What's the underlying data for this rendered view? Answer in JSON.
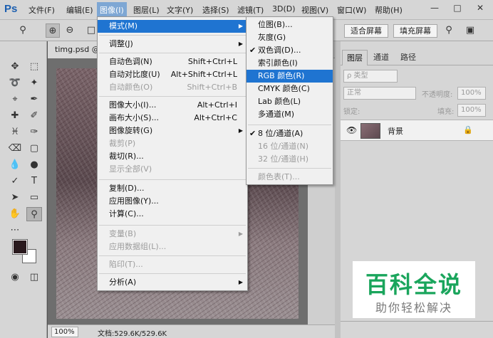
{
  "app": {
    "logo": "Ps"
  },
  "menubar": {
    "items": [
      "文件(F)",
      "编辑(E)",
      "图像(I)",
      "图层(L)",
      "文字(Y)",
      "选择(S)",
      "滤镜(T)",
      "3D(D)",
      "视图(V)",
      "窗口(W)",
      "帮助(H)"
    ],
    "active_index": 2
  },
  "window_controls": {
    "minimize": "—",
    "maximize": "□",
    "close": "✕"
  },
  "options_bar": {
    "fit_screen": "适合屏幕",
    "fill_screen": "填充屏幕"
  },
  "document": {
    "tab_label": "timg.psd @",
    "zoom": "100%",
    "info": "文档:529.6K/529.6K"
  },
  "image_menu": {
    "items": [
      {
        "label": "模式(M)",
        "shortcut": "",
        "submenu": true,
        "disabled": false,
        "highlighted": true
      },
      {
        "label": "调整(J)",
        "shortcut": "",
        "submenu": true,
        "disabled": false,
        "highlighted": false
      },
      {
        "label": "自动色调(N)",
        "shortcut": "Shift+Ctrl+L",
        "submenu": false,
        "disabled": false,
        "highlighted": false
      },
      {
        "label": "自动对比度(U)",
        "shortcut": "Alt+Shift+Ctrl+L",
        "submenu": false,
        "disabled": false,
        "highlighted": false
      },
      {
        "label": "自动颜色(O)",
        "shortcut": "Shift+Ctrl+B",
        "submenu": false,
        "disabled": true,
        "highlighted": false
      },
      {
        "label": "图像大小(I)...",
        "shortcut": "Alt+Ctrl+I",
        "submenu": false,
        "disabled": false,
        "highlighted": false
      },
      {
        "label": "画布大小(S)...",
        "shortcut": "Alt+Ctrl+C",
        "submenu": false,
        "disabled": false,
        "highlighted": false
      },
      {
        "label": "图像旋转(G)",
        "shortcut": "",
        "submenu": true,
        "disabled": false,
        "highlighted": false
      },
      {
        "label": "裁剪(P)",
        "shortcut": "",
        "submenu": false,
        "disabled": true,
        "highlighted": false
      },
      {
        "label": "裁切(R)...",
        "shortcut": "",
        "submenu": false,
        "disabled": false,
        "highlighted": false
      },
      {
        "label": "显示全部(V)",
        "shortcut": "",
        "submenu": false,
        "disabled": true,
        "highlighted": false
      },
      {
        "label": "复制(D)...",
        "shortcut": "",
        "submenu": false,
        "disabled": false,
        "highlighted": false
      },
      {
        "label": "应用图像(Y)...",
        "shortcut": "",
        "submenu": false,
        "disabled": false,
        "highlighted": false
      },
      {
        "label": "计算(C)...",
        "shortcut": "",
        "submenu": false,
        "disabled": false,
        "highlighted": false
      },
      {
        "label": "变量(B)",
        "shortcut": "",
        "submenu": true,
        "disabled": true,
        "highlighted": false
      },
      {
        "label": "应用数据组(L)...",
        "shortcut": "",
        "submenu": false,
        "disabled": true,
        "highlighted": false
      },
      {
        "label": "陷印(T)...",
        "shortcut": "",
        "submenu": false,
        "disabled": true,
        "highlighted": false
      },
      {
        "label": "分析(A)",
        "shortcut": "",
        "submenu": true,
        "disabled": false,
        "highlighted": false
      }
    ]
  },
  "mode_submenu": {
    "items": [
      {
        "label": "位图(B)...",
        "checked": false,
        "disabled": false,
        "highlighted": false
      },
      {
        "label": "灰度(G)",
        "checked": false,
        "disabled": false,
        "highlighted": false
      },
      {
        "label": "双色调(D)...",
        "checked": true,
        "disabled": false,
        "highlighted": false
      },
      {
        "label": "索引颜色(I)",
        "checked": false,
        "disabled": false,
        "highlighted": false
      },
      {
        "label": "RGB 颜色(R)",
        "checked": false,
        "disabled": false,
        "highlighted": true
      },
      {
        "label": "CMYK 颜色(C)",
        "checked": false,
        "disabled": false,
        "highlighted": false
      },
      {
        "label": "Lab 颜色(L)",
        "checked": false,
        "disabled": false,
        "highlighted": false
      },
      {
        "label": "多通道(M)",
        "checked": false,
        "disabled": false,
        "highlighted": false
      },
      {
        "label": "8 位/通道(A)",
        "checked": true,
        "disabled": false,
        "highlighted": false
      },
      {
        "label": "16 位/通道(N)",
        "checked": false,
        "disabled": true,
        "highlighted": false
      },
      {
        "label": "32 位/通道(H)",
        "checked": false,
        "disabled": true,
        "highlighted": false
      },
      {
        "label": "颜色表(T)...",
        "checked": false,
        "disabled": true,
        "highlighted": false
      }
    ]
  },
  "layers_panel": {
    "tabs": [
      "图层",
      "通道",
      "路径"
    ],
    "filter_label": "ρ 类型",
    "blend_mode": "正常",
    "opacity_label": "不透明度:",
    "opacity_value": "100%",
    "lock_label": "锁定:",
    "fill_label": "填充:",
    "fill_value": "100%",
    "layer_name": "背景"
  },
  "watermark": {
    "title": "百科全说",
    "subtitle": "助你轻松解决"
  },
  "colors": {
    "menu_highlight": "#1f74d1",
    "watermark_green": "#1aa55c",
    "foreground": "#2a1a1e",
    "background": "#ffffff"
  }
}
